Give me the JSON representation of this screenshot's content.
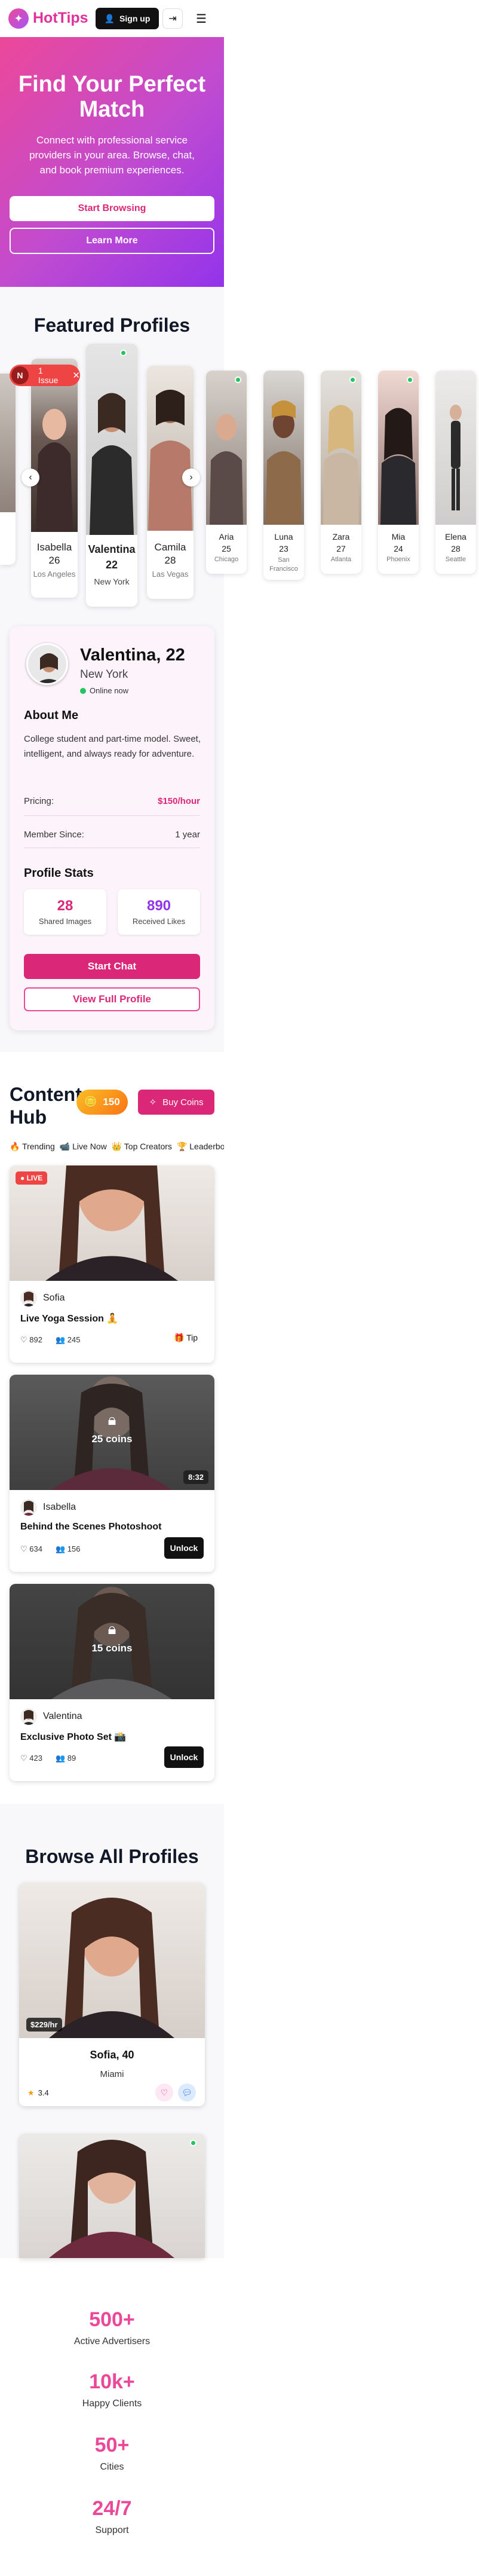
{
  "header": {
    "brand": "HotTips",
    "signup_label": "Sign up"
  },
  "hero": {
    "title": "Find Your Perfect Match",
    "subtitle": "Connect with professional service providers in your area. Browse, chat, and book premium experiences.",
    "primary_label": "Start Browsing",
    "secondary_label": "Learn More"
  },
  "featured": {
    "title": "Featured Profiles",
    "issue_badge": {
      "letter": "N",
      "label": "1 Issue"
    },
    "cards": [
      {
        "name": "Isabella",
        "age": "26",
        "city": "Los Angeles"
      },
      {
        "name": "Valentina",
        "age": "22",
        "city": "New York"
      },
      {
        "name": "Camila",
        "age": "28",
        "city": "Las Vegas"
      },
      {
        "name": "Aria",
        "age": "25",
        "city": "Chicago"
      },
      {
        "name": "Luna",
        "age": "23",
        "city": "San Francisco"
      },
      {
        "name": "Zara",
        "age": "27",
        "city": "Atlanta"
      },
      {
        "name": "Mia",
        "age": "24",
        "city": "Phoenix"
      },
      {
        "name": "Elena",
        "age": "28",
        "city": "Seattle"
      }
    ]
  },
  "detail": {
    "name": "Valentina, 22",
    "city": "New York",
    "status": "Online now",
    "about_title": "About Me",
    "about": "College student and part-time model. Sweet, intelligent, and always ready for adventure.",
    "pricing_label": "Pricing:",
    "pricing_value": "$150/hour",
    "member_label": "Member Since:",
    "member_value": "1 year",
    "stats_title": "Profile Stats",
    "shared_images": "28",
    "shared_images_label": "Shared Images",
    "received_likes": "890",
    "received_likes_label": "Received Likes",
    "chat_label": "Start Chat",
    "view_label": "View Full Profile"
  },
  "hub": {
    "title": "Content Hub",
    "coins": "150",
    "buy_label": "Buy Coins",
    "tabs": [
      "🔥 Trending",
      "📹 Live Now",
      "👑 Top Creators",
      "🏆 Leaderboard"
    ],
    "posts": [
      {
        "badge": "● LIVE",
        "author": "Sofia",
        "title": "Live Yoga Session 🧘",
        "likes": "892",
        "views": "245",
        "action": "Tip"
      },
      {
        "lock": "25 coins",
        "duration": "8:32",
        "author": "Isabella",
        "title": "Behind the Scenes Photoshoot",
        "likes": "634",
        "views": "156",
        "action": "Unlock"
      },
      {
        "lock": "15 coins",
        "author": "Valentina",
        "title": "Exclusive Photo Set 📸",
        "likes": "423",
        "views": "89",
        "action": "Unlock"
      }
    ]
  },
  "browse": {
    "title": "Browse All Profiles",
    "card": {
      "price": "$229/hr",
      "name": "Sofia, 40",
      "city": "Miami",
      "rating": "3.4"
    }
  },
  "stats": [
    {
      "value": "500+",
      "label": "Active Advertisers"
    },
    {
      "value": "10k+",
      "label": "Happy Clients"
    },
    {
      "value": "50+",
      "label": "Cities"
    },
    {
      "value": "24/7",
      "label": "Support"
    }
  ],
  "colors": {
    "brand_pink": "#db2777",
    "brand_purple": "#9333ea",
    "online_green": "#22c55e",
    "live_red": "#ef4444"
  }
}
